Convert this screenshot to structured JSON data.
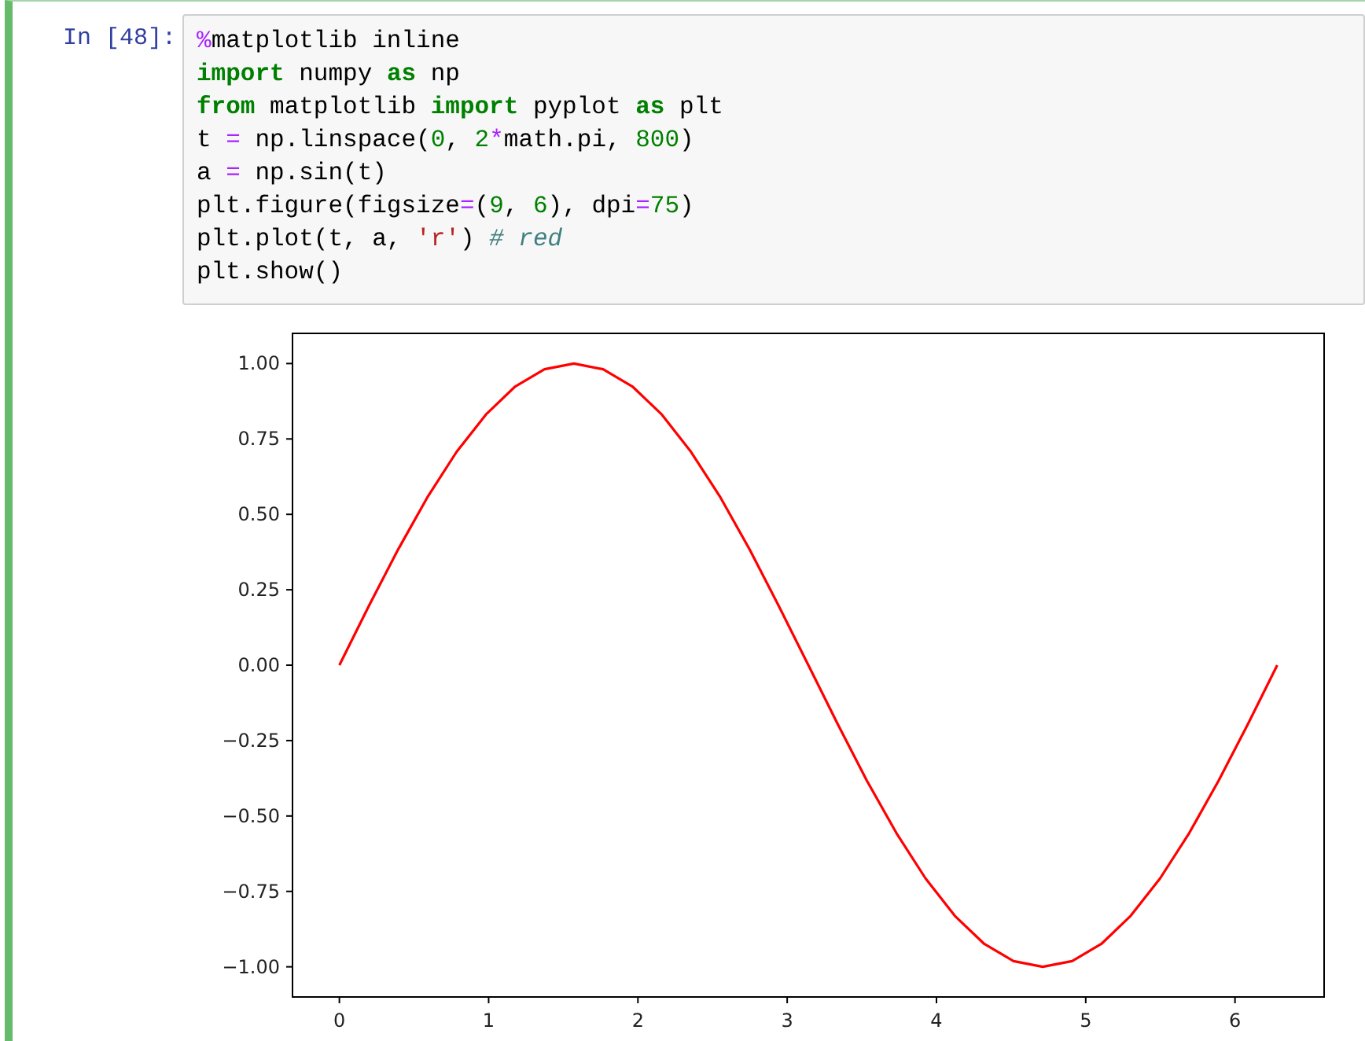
{
  "cell": {
    "prompt": "In [48]:",
    "code_lines": [
      {
        "tokens": [
          {
            "kind": "magic",
            "text": "%"
          },
          {
            "kind": "plain",
            "text": "matplotlib inline"
          }
        ]
      },
      {
        "tokens": [
          {
            "kind": "keyword",
            "text": "import"
          },
          {
            "kind": "plain",
            "text": " numpy "
          },
          {
            "kind": "keyword",
            "text": "as"
          },
          {
            "kind": "plain",
            "text": " np"
          }
        ]
      },
      {
        "tokens": [
          {
            "kind": "keyword",
            "text": "from"
          },
          {
            "kind": "plain",
            "text": " matplotlib "
          },
          {
            "kind": "keyword",
            "text": "import"
          },
          {
            "kind": "plain",
            "text": " pyplot "
          },
          {
            "kind": "keyword",
            "text": "as"
          },
          {
            "kind": "plain",
            "text": " plt"
          }
        ]
      },
      {
        "tokens": [
          {
            "kind": "plain",
            "text": "t "
          },
          {
            "kind": "operator",
            "text": "="
          },
          {
            "kind": "plain",
            "text": " np.linspace("
          },
          {
            "kind": "number",
            "text": "0"
          },
          {
            "kind": "plain",
            "text": ", "
          },
          {
            "kind": "number",
            "text": "2"
          },
          {
            "kind": "operator",
            "text": "*"
          },
          {
            "kind": "plain",
            "text": "math.pi, "
          },
          {
            "kind": "number",
            "text": "800"
          },
          {
            "kind": "plain",
            "text": ")"
          }
        ]
      },
      {
        "tokens": [
          {
            "kind": "plain",
            "text": "a "
          },
          {
            "kind": "operator",
            "text": "="
          },
          {
            "kind": "plain",
            "text": " np.sin(t)"
          }
        ]
      },
      {
        "tokens": [
          {
            "kind": "plain",
            "text": "plt.figure(figsize"
          },
          {
            "kind": "operator",
            "text": "="
          },
          {
            "kind": "plain",
            "text": "("
          },
          {
            "kind": "number",
            "text": "9"
          },
          {
            "kind": "plain",
            "text": ", "
          },
          {
            "kind": "number",
            "text": "6"
          },
          {
            "kind": "plain",
            "text": "), dpi"
          },
          {
            "kind": "operator",
            "text": "="
          },
          {
            "kind": "number",
            "text": "75"
          },
          {
            "kind": "plain",
            "text": ")"
          }
        ]
      },
      {
        "tokens": [
          {
            "kind": "plain",
            "text": "plt.plot(t, a, "
          },
          {
            "kind": "string",
            "text": "'r'"
          },
          {
            "kind": "plain",
            "text": ") "
          },
          {
            "kind": "comment",
            "text": "# red"
          }
        ]
      },
      {
        "tokens": [
          {
            "kind": "plain",
            "text": "plt.show()"
          }
        ]
      }
    ]
  },
  "output": {
    "chart_data": {
      "type": "line",
      "x": [
        0,
        0.196,
        0.393,
        0.589,
        0.785,
        0.982,
        1.178,
        1.374,
        1.571,
        1.767,
        1.963,
        2.16,
        2.356,
        2.553,
        2.749,
        2.945,
        3.142,
        3.338,
        3.534,
        3.731,
        3.927,
        4.123,
        4.32,
        4.516,
        4.712,
        4.909,
        5.105,
        5.301,
        5.498,
        5.694,
        5.89,
        6.087,
        6.283
      ],
      "series": [
        {
          "color": "#ff0000",
          "values": [
            0,
            0.195,
            0.383,
            0.556,
            0.707,
            0.831,
            0.924,
            0.981,
            1,
            0.981,
            0.924,
            0.831,
            0.707,
            0.556,
            0.383,
            0.195,
            0,
            -0.195,
            -0.383,
            -0.556,
            -0.707,
            -0.831,
            -0.924,
            -0.981,
            -1,
            -0.981,
            -0.924,
            -0.831,
            -0.707,
            -0.556,
            -0.383,
            -0.195,
            0
          ]
        }
      ],
      "xlim": [
        -0.314,
        6.597
      ],
      "ylim": [
        -1.1,
        1.1
      ],
      "xticks": [
        0,
        1,
        2,
        3,
        4,
        5,
        6
      ],
      "yticks": [
        {
          "value": 1,
          "label": "1.00"
        },
        {
          "value": 0.75,
          "label": "0.75"
        },
        {
          "value": 0.5,
          "label": "0.50"
        },
        {
          "value": 0.25,
          "label": "0.25"
        },
        {
          "value": 0,
          "label": "0.00"
        },
        {
          "value": -0.25,
          "label": "−0.25"
        },
        {
          "value": -0.5,
          "label": "−0.50"
        },
        {
          "value": -0.75,
          "label": "−0.75"
        },
        {
          "value": -1,
          "label": "−1.00"
        }
      ]
    }
  }
}
